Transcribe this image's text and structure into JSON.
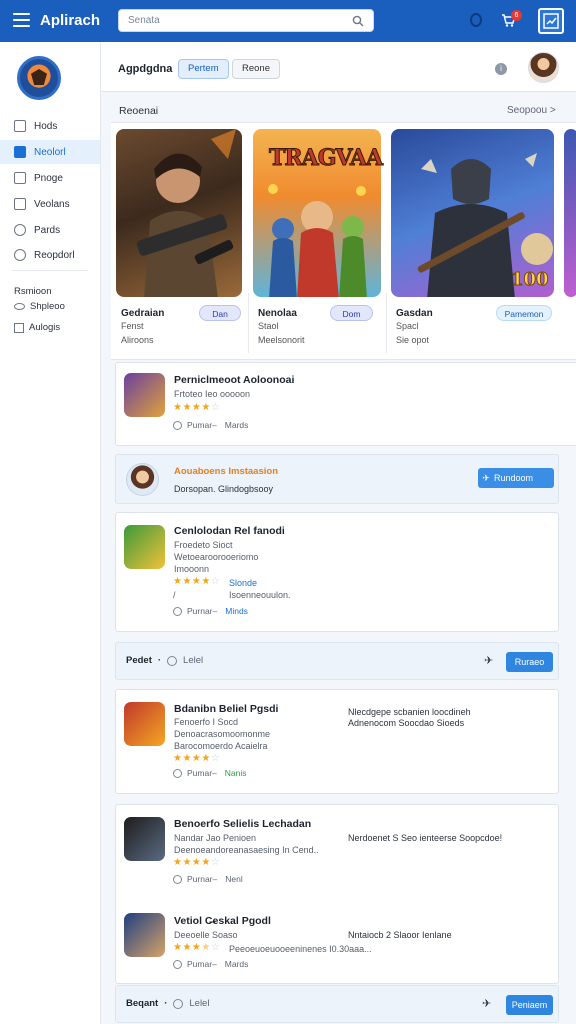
{
  "topbar": {
    "app_title": "Aplirach",
    "search_placeholder": "Senata",
    "notification_count": "6",
    "accent_color": "#1a5fbd"
  },
  "sidebar": {
    "items": [
      {
        "label": "Hods",
        "icon": "home-icon"
      },
      {
        "label": "Neolorl",
        "icon": "bookmark-icon",
        "active": true
      },
      {
        "label": "Pnoge",
        "icon": "pages-icon"
      },
      {
        "label": "Veolans",
        "icon": "library-icon"
      },
      {
        "label": "Pards",
        "icon": "clock-icon"
      },
      {
        "label": "Reopdorl",
        "icon": "settings-icon"
      }
    ],
    "extra_items": [
      {
        "label": "Rsmioon",
        "icon": "bag-icon"
      },
      {
        "label": "Shpleoo",
        "icon": "oval-icon"
      },
      {
        "label": "Aulogis",
        "icon": "grid-icon"
      }
    ]
  },
  "subheader": {
    "title": "Agpdgdna",
    "chips": [
      "Pertem",
      "Reone"
    ],
    "active_chip": 0
  },
  "featured": {
    "section_title": "Reoenai",
    "see_all": "Seopoou >",
    "cards": [
      {
        "title": "Gedraian",
        "line1": "Fenst",
        "line2": "Aliroons",
        "pill": "Dan",
        "art_text": ""
      },
      {
        "title": "Nenolaa",
        "line1": "Staol",
        "line2": "Meelsonorit",
        "pill": "Dom",
        "art_text": "TRAGVAA"
      },
      {
        "title": "Gasdan",
        "line1": "Spacl",
        "line2": "Sie opot",
        "pill": "Pamemon",
        "art_text": "100"
      }
    ]
  },
  "list": [
    {
      "title": "Perniclmeoot Aoloonoai",
      "lines": [
        "Frtoteo Ieo ooooon"
      ],
      "rating": 4,
      "meta": "Pumar–",
      "tag": "Mards",
      "tag_color": "#5b6676"
    },
    {
      "title": "Cenlolodan Rel fanodi",
      "lines": [
        "Froedeto Sioct",
        "Wetoearoorooeriomo",
        "Imooonn"
      ],
      "rating": 4,
      "side": [
        "Slonde",
        "Isoenneouulon."
      ],
      "meta": "Purnar–",
      "tag": "Minds",
      "tag_color": "#1a6fd6"
    },
    {
      "title": "Bdanibn Beliel Pgsdi",
      "lines": [
        "Fenoerfo I Socd",
        "Denoacrasomoomonme",
        "Barocomoerdo Acaielra"
      ],
      "rating": 4,
      "right_text": "Nlecdgepe scbanien loocdineh Adnenocom Soocdao Sioeds",
      "meta": "Pumar–",
      "tag": "Nanis",
      "tag_color": "#2e9d46"
    },
    {
      "title": "Benoerfo Selielis Lechadan",
      "lines": [
        "Nandar Jao Penioen",
        "Deenoeandoreanasaesing In Cend.."
      ],
      "rating": 4,
      "right_text": "Nerdoenet S Seo ienteerse Soopcdoe!",
      "meta": "Purnar–",
      "tag": "Nenl",
      "tag_color": "#5b6676"
    },
    {
      "title": "Vetiol C̶eskal Pgodl",
      "lines": [
        "Deeoelle Soaso"
      ],
      "rating": 3.5,
      "side": [
        "Peeoeuoeuooeeninenes I0.30aaa..."
      ],
      "right_text": "Nntaiocb 2 Slaoor Ienlane",
      "meta": "Pumar–",
      "tag": "Mards",
      "tag_color": "#5b6676"
    }
  ],
  "promo": {
    "title": "Aouaboens Imstaasion",
    "subtitle": "Dorsopan.   Glindogbsooy",
    "button": "Rundoom"
  },
  "strips": [
    {
      "label": "Pedet",
      "sub": "Lelel",
      "button": "Ruraeo"
    },
    {
      "label": "Beqant",
      "sub": "Lelel",
      "button": "Peniaem"
    }
  ]
}
